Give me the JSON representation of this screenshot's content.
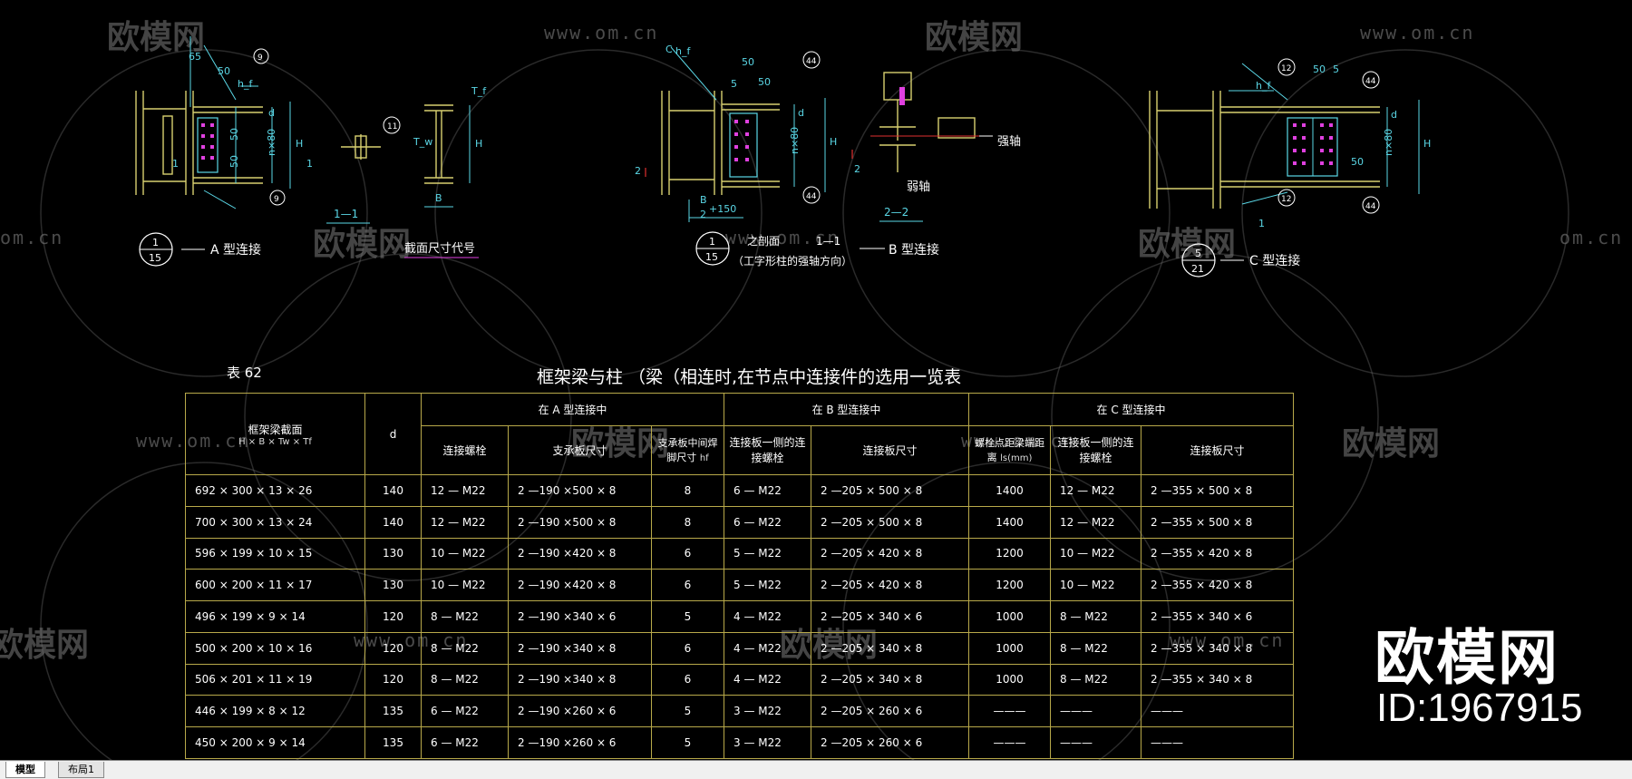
{
  "watermark": {
    "brand": "欧模网",
    "url": "www.om.cn",
    "url_fragment": "om.cn",
    "id": "ID:1967915"
  },
  "drawings": {
    "a": {
      "section_no": "1",
      "sheet_no": "15",
      "caption": "A 型连接",
      "section_mark": "1—1",
      "section_caption": "截面尺寸代号",
      "dims": [
        "65",
        "50",
        "50",
        "50",
        "d",
        "H",
        "n×80",
        "h_f",
        "1",
        "1",
        "T_w",
        "T_f",
        "B"
      ],
      "weld_marks": [
        "9",
        "9",
        "11"
      ]
    },
    "b": {
      "section_no": "1",
      "sheet_no": "15",
      "caption_line1": "之剖面",
      "caption_line2": "（工字形柱的强轴方向）",
      "mark": "1—1",
      "caption": "B 型连接",
      "section_mark": "2—2",
      "axis_strong": "强轴",
      "axis_weak": "弱轴",
      "dims": [
        "C",
        "h_f",
        "50",
        "5",
        "50",
        "d",
        "H",
        "n×80",
        "B",
        "2",
        "+150",
        "2",
        "2"
      ],
      "weld_marks": [
        "44",
        "44"
      ]
    },
    "c": {
      "section_no": "5",
      "sheet_no": "21",
      "caption": "C 型连接",
      "dims": [
        "h_f",
        "50",
        "5",
        "d",
        "H",
        "n×80",
        "50",
        "1"
      ],
      "weld_marks": [
        "12",
        "12",
        "44",
        "44"
      ]
    }
  },
  "table": {
    "label": "表 62",
    "title": "框架梁与柱  （梁（相连时,在节点中连接件的选用一览表",
    "headers": {
      "section": "框架梁截面",
      "section_sub": "H × B × Tw × Tf",
      "d": "d",
      "group_a": "在 A 型连接中",
      "group_b": "在 B 型连接中",
      "group_c": "在 C 型连接中",
      "a_bolts": "连接螺栓",
      "a_plate": "支承板尺寸",
      "a_weld": "支承板中间焊脚尺寸",
      "a_weld_sub": "hf",
      "b_bolts": "连接板一侧的连接螺栓",
      "b_plate": "连接板尺寸",
      "c_dist": "螺栓点距梁端距离",
      "c_dist_sub": "ls(mm)",
      "c_bolts": "连接板一侧的连接螺栓",
      "c_plate": "连接板尺寸"
    },
    "rows": [
      [
        "692 × 300 × 13 × 26",
        "140",
        "12 — M22",
        "2 —190 ×500 × 8",
        "8",
        "6 — M22",
        "2 —205 × 500 × 8",
        "1400",
        "12 — M22",
        "2 —355 × 500 × 8"
      ],
      [
        "700 × 300 × 13 × 24",
        "140",
        "12 — M22",
        "2 —190 ×500 × 8",
        "8",
        "6 — M22",
        "2 —205 × 500 × 8",
        "1400",
        "12 — M22",
        "2 —355 × 500 × 8"
      ],
      [
        "596 × 199 × 10 × 15",
        "130",
        "10 — M22",
        "2 —190 ×420 × 8",
        "6",
        "5 — M22",
        "2 —205 × 420 × 8",
        "1200",
        "10 — M22",
        "2 —355 × 420 × 8"
      ],
      [
        "600 × 200 × 11 × 17",
        "130",
        "10 — M22",
        "2 —190 ×420 × 8",
        "6",
        "5 — M22",
        "2 —205 × 420 × 8",
        "1200",
        "10 — M22",
        "2 —355 × 420 × 8"
      ],
      [
        "496 × 199 × 9 × 14",
        "120",
        "8 — M22",
        "2 —190 ×340 × 6",
        "5",
        "4 — M22",
        "2 —205 × 340 × 6",
        "1000",
        "8 — M22",
        "2 —355 × 340 × 6"
      ],
      [
        "500 × 200 × 10 × 16",
        "120",
        "8 — M22",
        "2 —190 ×340 × 8",
        "6",
        "4 — M22",
        "2 —205 × 340 × 8",
        "1000",
        "8 — M22",
        "2 —355 × 340 × 8"
      ],
      [
        "506 × 201 × 11 × 19",
        "120",
        "8 — M22",
        "2 —190 ×340 × 8",
        "6",
        "4 — M22",
        "2 —205 × 340 × 8",
        "1000",
        "8 — M22",
        "2 —355 × 340 × 8"
      ],
      [
        "446 × 199 × 8 × 12",
        "135",
        "6 — M22",
        "2 —190 ×260 × 6",
        "5",
        "3 — M22",
        "2 —205 × 260 × 6",
        "———",
        "———",
        "———"
      ],
      [
        "450 × 200 × 9 × 14",
        "135",
        "6 — M22",
        "2 —190 ×260 × 6",
        "5",
        "3 — M22",
        "2 —205 × 260 × 6",
        "———",
        "———",
        "———"
      ]
    ]
  },
  "tabs": {
    "model": "模型",
    "layout1": "布局1"
  },
  "colors": {
    "background": "#000000",
    "table_border": "#b8a94a",
    "cyan_dim": "#5ad7e6",
    "yellow_steel": "#d8d070",
    "magenta_bolts": "#e040e0",
    "red_mark": "#e03030"
  }
}
